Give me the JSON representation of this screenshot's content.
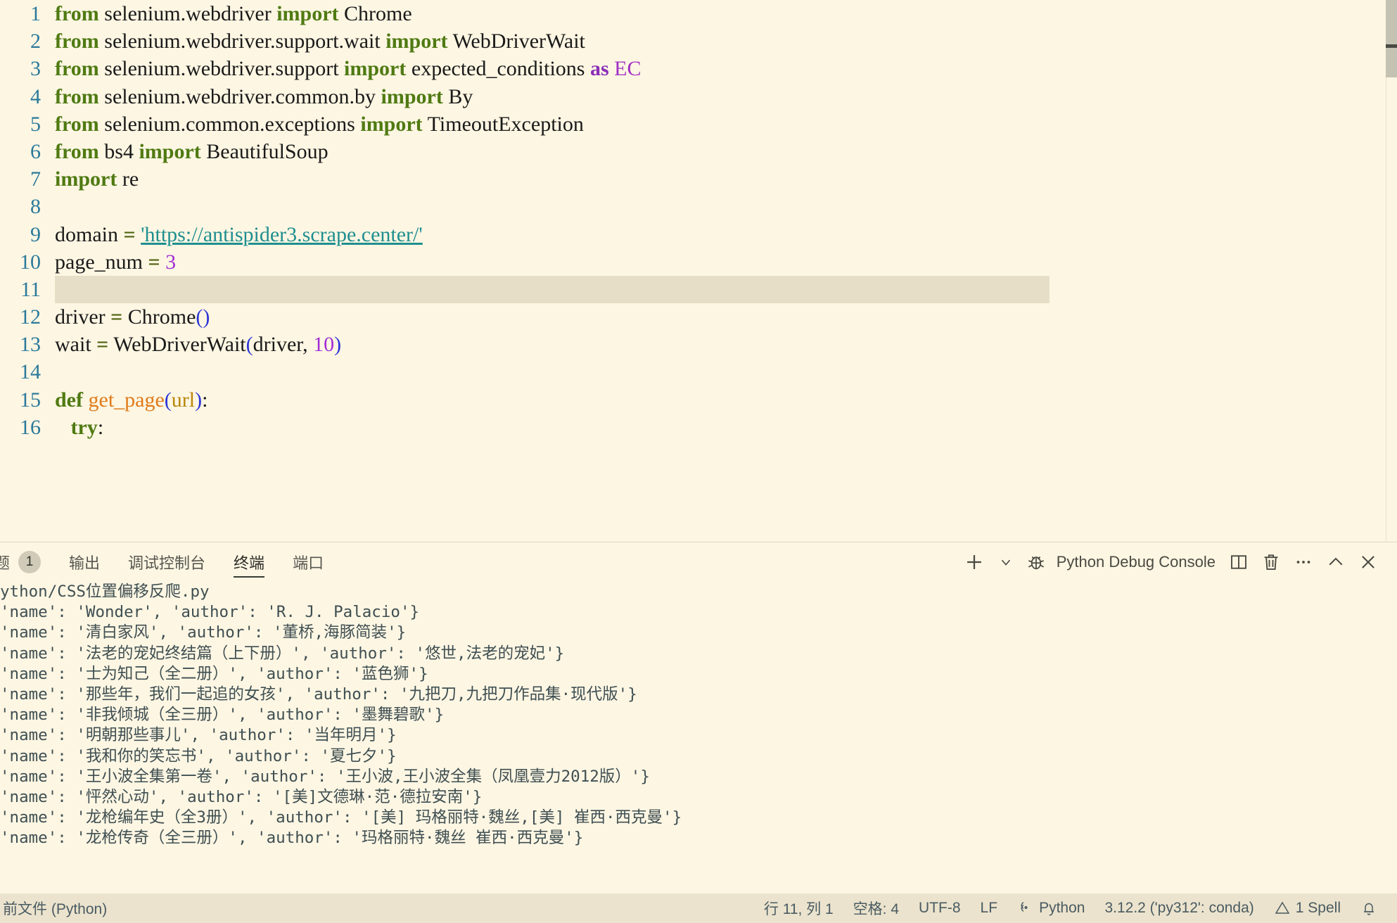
{
  "editor": {
    "lines": [
      {
        "n": "1",
        "tokens": [
          {
            "t": "from",
            "c": "kw"
          },
          {
            "t": " selenium.webdriver ",
            "c": "mod"
          },
          {
            "t": "import",
            "c": "kw"
          },
          {
            "t": " Chrome",
            "c": "cls"
          }
        ]
      },
      {
        "n": "2",
        "tokens": [
          {
            "t": "from",
            "c": "kw"
          },
          {
            "t": " selenium.webdriver.support.wait ",
            "c": "mod"
          },
          {
            "t": "import",
            "c": "kw"
          },
          {
            "t": " WebDriverWait",
            "c": "cls"
          }
        ]
      },
      {
        "n": "3",
        "tokens": [
          {
            "t": "from",
            "c": "kw"
          },
          {
            "t": " selenium.webdriver.support ",
            "c": "mod"
          },
          {
            "t": "import",
            "c": "kw"
          },
          {
            "t": " expected_conditions ",
            "c": "cls"
          },
          {
            "t": "as",
            "c": "kw2"
          },
          {
            "t": " ",
            "c": "nm"
          },
          {
            "t": "EC",
            "c": "ecv"
          }
        ]
      },
      {
        "n": "4",
        "tokens": [
          {
            "t": "from",
            "c": "kw"
          },
          {
            "t": " selenium.webdriver.common.by ",
            "c": "mod"
          },
          {
            "t": "import",
            "c": "kw"
          },
          {
            "t": " By",
            "c": "cls"
          }
        ]
      },
      {
        "n": "5",
        "tokens": [
          {
            "t": "from",
            "c": "kw"
          },
          {
            "t": " selenium.common.exceptions ",
            "c": "mod"
          },
          {
            "t": "import",
            "c": "kw"
          },
          {
            "t": " TimeoutException",
            "c": "cls"
          }
        ]
      },
      {
        "n": "6",
        "tokens": [
          {
            "t": "from",
            "c": "kw"
          },
          {
            "t": " bs4 ",
            "c": "mod"
          },
          {
            "t": "import",
            "c": "kw"
          },
          {
            "t": " BeautifulSoup",
            "c": "cls"
          }
        ]
      },
      {
        "n": "7",
        "tokens": [
          {
            "t": "import",
            "c": "kw"
          },
          {
            "t": " re",
            "c": "mod"
          }
        ]
      },
      {
        "n": "8",
        "tokens": []
      },
      {
        "n": "9",
        "tokens": [
          {
            "t": "domain ",
            "c": "nm"
          },
          {
            "t": "=",
            "c": "op"
          },
          {
            "t": " ",
            "c": "nm"
          },
          {
            "t": "'https://antispider3.scrape.center/'",
            "c": "str"
          }
        ]
      },
      {
        "n": "10",
        "tokens": [
          {
            "t": "page_num ",
            "c": "nm"
          },
          {
            "t": "=",
            "c": "op"
          },
          {
            "t": " ",
            "c": "nm"
          },
          {
            "t": "3",
            "c": "num"
          }
        ]
      },
      {
        "n": "11",
        "tokens": [],
        "highlight": true
      },
      {
        "n": "12",
        "tokens": [
          {
            "t": "driver ",
            "c": "nm"
          },
          {
            "t": "=",
            "c": "op"
          },
          {
            "t": " Chrome",
            "c": "cls"
          },
          {
            "t": "()",
            "c": "par"
          }
        ]
      },
      {
        "n": "13",
        "tokens": [
          {
            "t": "wait ",
            "c": "nm"
          },
          {
            "t": "=",
            "c": "op"
          },
          {
            "t": " WebDriverWait",
            "c": "cls"
          },
          {
            "t": "(",
            "c": "par"
          },
          {
            "t": "driver, ",
            "c": "nm"
          },
          {
            "t": "10",
            "c": "num"
          },
          {
            "t": ")",
            "c": "par"
          }
        ]
      },
      {
        "n": "14",
        "tokens": []
      },
      {
        "n": "15",
        "tokens": [
          {
            "t": "def",
            "c": "kw"
          },
          {
            "t": " ",
            "c": "nm"
          },
          {
            "t": "get_page",
            "c": "fn"
          },
          {
            "t": "(",
            "c": "par"
          },
          {
            "t": "url",
            "c": "arg"
          },
          {
            "t": ")",
            "c": "par"
          },
          {
            "t": ":",
            "c": "pn"
          }
        ]
      },
      {
        "n": "16",
        "tokens": [
          {
            "t": "   ",
            "c": "nm"
          },
          {
            "t": "try",
            "c": "kw"
          },
          {
            "t": ":",
            "c": "pn"
          }
        ]
      }
    ]
  },
  "panel": {
    "tabs": [
      {
        "label": "题",
        "badge": "1",
        "active": false
      },
      {
        "label": "输出",
        "badge": null,
        "active": false
      },
      {
        "label": "调试控制台",
        "badge": null,
        "active": false
      },
      {
        "label": "终端",
        "badge": null,
        "active": true
      },
      {
        "label": "端口",
        "badge": null,
        "active": false
      }
    ],
    "actions": {
      "new_terminal": "new-terminal-icon",
      "new_terminal_dropdown": "chevron-down-icon",
      "terminal_kind_icon": "bug-icon",
      "terminal_name": "Python Debug Console",
      "split": "split-terminal-icon",
      "kill": "trash-icon",
      "more": "ellipsis-icon",
      "maximize": "chevron-up-icon",
      "close": "close-icon"
    }
  },
  "terminal": {
    "lines": [
      "ython/CSS位置偏移反爬.py",
      "'name': 'Wonder', 'author': 'R. J. Palacio'}",
      "'name': '清白家风', 'author': '董桥,海豚简装'}",
      "'name': '法老的宠妃终结篇（上下册）', 'author': '悠世,法老的宠妃'}",
      "'name': '士为知己（全二册）', 'author': '蓝色狮'}",
      "'name': '那些年，我们一起追的女孩', 'author': '九把刀,九把刀作品集·现代版'}",
      "'name': '非我倾城（全三册）', 'author': '墨舞碧歌'}",
      "'name': '明朝那些事儿', 'author': '当年明月'}",
      "'name': '我和你的笑忘书', 'author': '夏七夕'}",
      "'name': '王小波全集第一卷', 'author': '王小波,王小波全集（凤凰壹力2012版）'}",
      "'name': '怦然心动', 'author': '[美]文德琳·范·德拉安南'}",
      "'name': '龙枪编年史（全3册）', 'author': '[美] 玛格丽特·魏丝,[美] 崔西·西克曼'}",
      "'name': '龙枪传奇（全三册）', 'author': '玛格丽特·魏丝 崔西·西克曼'}"
    ]
  },
  "statusbar": {
    "left": [
      {
        "label": "前文件 (Python)",
        "icon": null
      }
    ],
    "right": [
      {
        "name": "cursor-position",
        "label": "行 11, 列 1",
        "icon": null
      },
      {
        "name": "indentation",
        "label": "空格: 4",
        "icon": null
      },
      {
        "name": "encoding",
        "label": "UTF-8",
        "icon": null
      },
      {
        "name": "eol",
        "label": "LF",
        "icon": null
      },
      {
        "name": "language-mode",
        "label": "Python",
        "icon": "braces-icon"
      },
      {
        "name": "python-interpreter",
        "label": "3.12.2 ('py312': conda)",
        "icon": null
      },
      {
        "name": "spell-problems",
        "label": "1 Spell",
        "icon": "warning-icon"
      },
      {
        "name": "notifications",
        "label": "",
        "icon": "bell-icon"
      }
    ]
  },
  "colors": {
    "editor_bg": "#fdf6e3",
    "line_highlight": "#e6dec6",
    "status_bg": "#ebe3cd",
    "linenumber": "#2b7a9b",
    "keyword": "#4f7a12",
    "string": "#1f8f8f",
    "number": "#a12fd4",
    "function": "#e07b1a",
    "paren": "#2b35d6",
    "scrollbar_thumb": "#c4c2b2"
  }
}
